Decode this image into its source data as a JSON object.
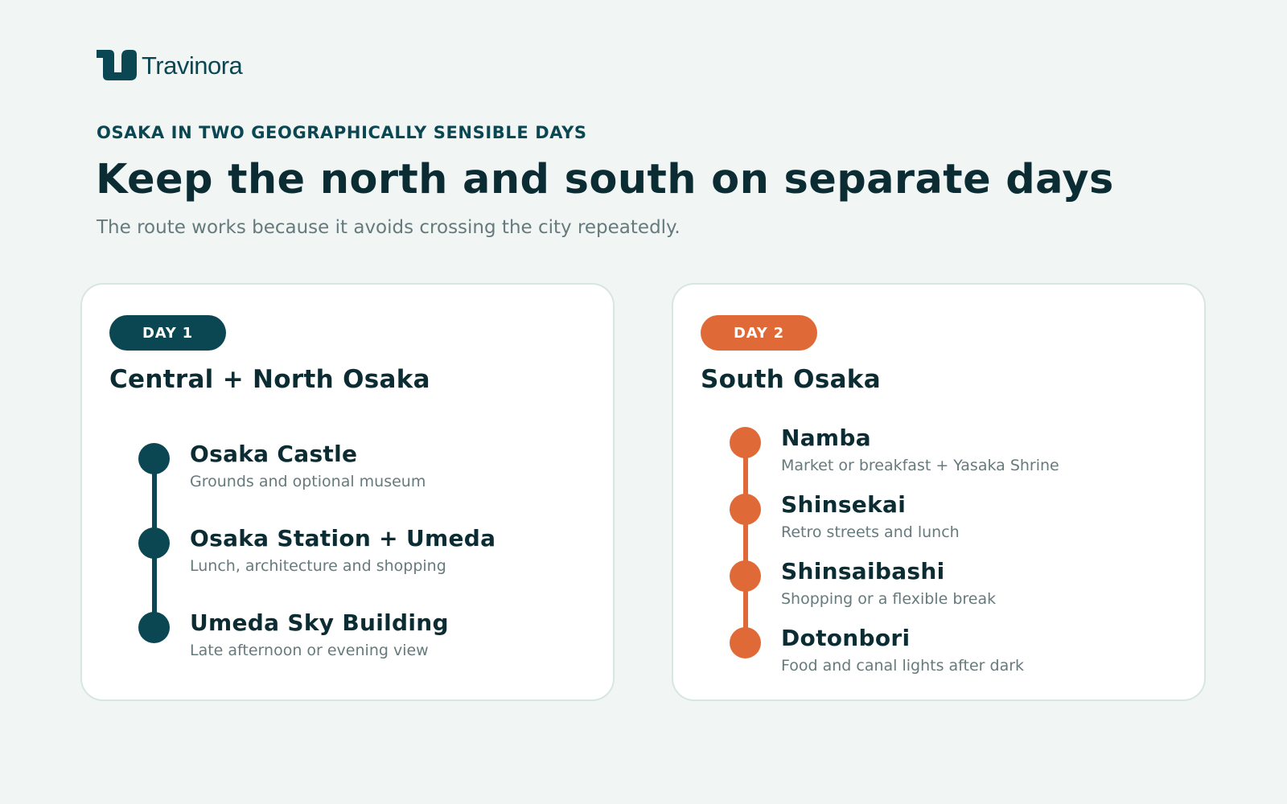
{
  "brand": {
    "name": "Travinora",
    "logo_icon": "travinora-logo-icon",
    "primary_color": "#0b4752",
    "accent_color": "#e06a37"
  },
  "header": {
    "eyebrow": "OSAKA IN TWO GEOGRAPHICALLY SENSIBLE DAYS",
    "title": "Keep the north and south on separate days",
    "subtitle": "The route works because it avoids crossing the city repeatedly."
  },
  "days": [
    {
      "badge": "DAY 1",
      "title": "Central + North Osaka",
      "color": "#0b4752",
      "stops": [
        {
          "name": "Osaka Castle",
          "desc": "Grounds and optional museum"
        },
        {
          "name": "Osaka Station + Umeda",
          "desc": "Lunch, architecture and shopping"
        },
        {
          "name": "Umeda Sky Building",
          "desc": "Late afternoon or evening view"
        }
      ]
    },
    {
      "badge": "DAY 2",
      "title": "South Osaka",
      "color": "#e06a37",
      "stops": [
        {
          "name": "Namba",
          "desc": "Market or breakfast + Yasaka Shrine"
        },
        {
          "name": "Shinsekai",
          "desc": "Retro streets and lunch"
        },
        {
          "name": "Shinsaibashi",
          "desc": "Shopping or a flexible break"
        },
        {
          "name": "Dotonbori",
          "desc": "Food and canal lights after dark"
        }
      ]
    }
  ]
}
